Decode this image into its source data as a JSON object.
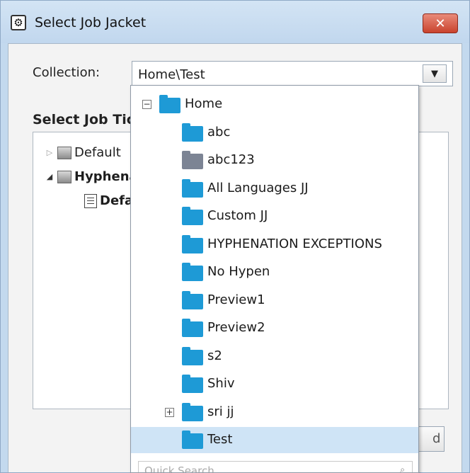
{
  "window": {
    "title": "Select Job Jacket",
    "close_label": "✕"
  },
  "collection": {
    "label": "Collection:",
    "value": "Home\\Test",
    "arrow": "▼"
  },
  "job_tickets": {
    "label": "Select Job Ticket",
    "items": [
      {
        "label": "Default",
        "expander": "▷"
      },
      {
        "label": "Hyphenation",
        "expander": "◢"
      },
      {
        "label": "Default"
      }
    ]
  },
  "dropdown": {
    "root": {
      "label": "Home",
      "expander": "⊟"
    },
    "items": [
      {
        "label": "abc"
      },
      {
        "label": "abc123"
      },
      {
        "label": "All Languages JJ"
      },
      {
        "label": "Custom JJ"
      },
      {
        "label": "HYPHENATION EXCEPTIONS"
      },
      {
        "label": "No Hypen"
      },
      {
        "label": "Preview1"
      },
      {
        "label": "Preview2"
      },
      {
        "label": "s2"
      },
      {
        "label": "Shiv"
      },
      {
        "label": "sri jj",
        "expander": "+"
      },
      {
        "label": "Test"
      }
    ],
    "selected": "Test",
    "quick_search": "Quick Search",
    "search_icon": "search-icon"
  },
  "bottom_button_fragment": "d",
  "colors": {
    "folder": "#1e9ad6",
    "folder_gray": "#7c8494",
    "selection": "#cfe4f6",
    "close_button": "#c9432e"
  }
}
